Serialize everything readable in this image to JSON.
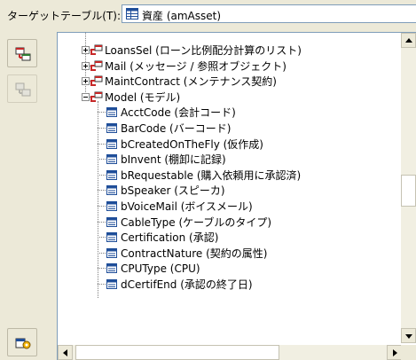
{
  "target": {
    "label": "ターゲットテーブル(T):",
    "value": "資産 (amAsset)"
  },
  "sidebar": {
    "buttons": [
      {
        "name": "add-link-button",
        "enabled": true
      },
      {
        "name": "remove-link-button",
        "enabled": false
      },
      {
        "name": "options-button",
        "enabled": true
      }
    ]
  },
  "tree": {
    "links": [
      {
        "label": "LoansSel (ローン比例配分計算のリスト)",
        "expanded": false
      },
      {
        "label": "Mail (メッセージ / 参照オブジェクト)",
        "expanded": false
      },
      {
        "label": "MaintContract (メンテナンス契約)",
        "expanded": false
      },
      {
        "label": "Model (モデル)",
        "expanded": true
      }
    ],
    "fields": [
      {
        "label": "AcctCode (会計コード)"
      },
      {
        "label": "BarCode (バーコード)"
      },
      {
        "label": "bCreatedOnTheFly (仮作成)"
      },
      {
        "label": "bInvent (棚卸に記録)"
      },
      {
        "label": "bRequestable (購入依頼用に承認済)"
      },
      {
        "label": "bSpeaker (スピーカ)"
      },
      {
        "label": "bVoiceMail (ボイスメール)"
      },
      {
        "label": "CableType (ケーブルのタイプ)"
      },
      {
        "label": "Certification (承認)"
      },
      {
        "label": "ContractNature (契約の属性)"
      },
      {
        "label": "CPUType (CPU)"
      },
      {
        "label": "dCertifEnd (承認の終了日)"
      }
    ]
  },
  "colors": {
    "selection": "#316ac5",
    "link_icon_red": "#c62828",
    "field_icon_blue": "#1f4e99"
  }
}
